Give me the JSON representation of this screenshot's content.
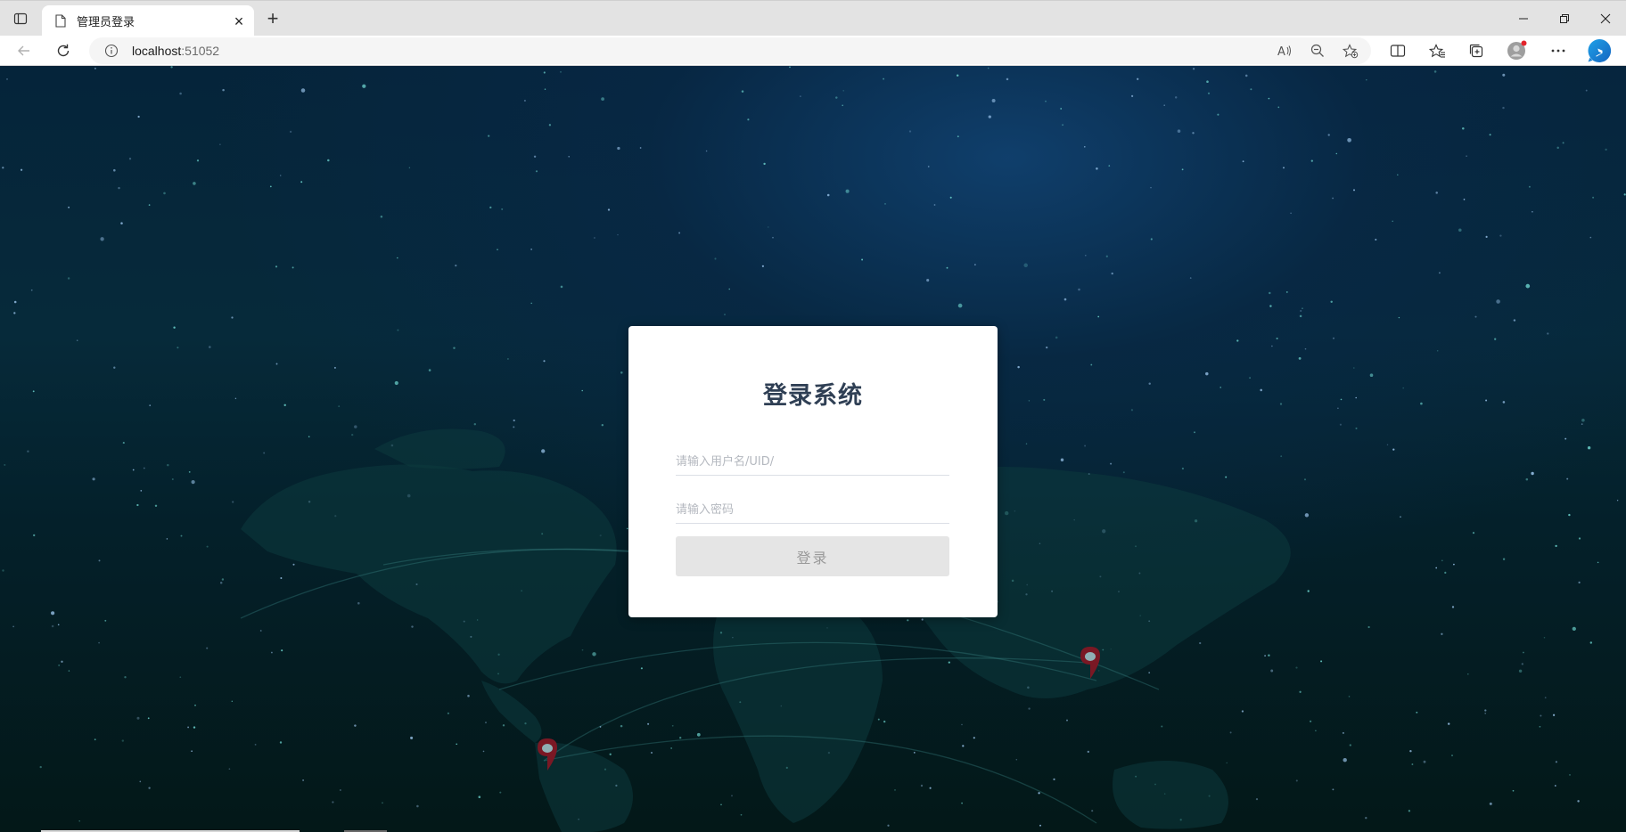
{
  "browser": {
    "tab": {
      "title": "管理员登录",
      "close_glyph": "×",
      "icon": "page-icon"
    },
    "new_tab_glyph": "+",
    "window_controls": {
      "minimize": "minimize-icon",
      "restore": "restore-icon",
      "close": "close-icon"
    },
    "address_bar": {
      "host": "localhost",
      "port": ":51052"
    },
    "toolbar_icons": [
      "back-icon",
      "refresh-icon",
      "info-icon",
      "read-aloud-icon",
      "zoom-out-icon",
      "add-favorite-icon",
      "split-screen-icon",
      "favorites-icon",
      "collections-icon",
      "profile-icon",
      "more-icon",
      "bing-icon"
    ]
  },
  "login": {
    "title": "登录系统",
    "username_placeholder": "请输入用户名/UID/",
    "password_placeholder": "请输入密码",
    "submit_label": "登录"
  },
  "colors": {
    "background_dark": "#031818",
    "background_blue": "#0b3f6b",
    "title_text": "#2f3f54",
    "button_bg": "#e5e5e5",
    "button_text": "#9a9a9a",
    "map_marker": "#8a1f2a"
  }
}
